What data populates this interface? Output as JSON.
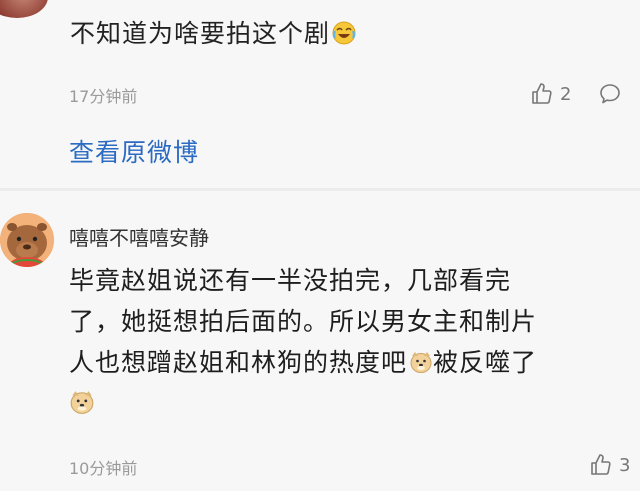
{
  "comment1": {
    "text": "不知道为啥要拍这个剧",
    "emoji_icon": "laugh-cry-emoji-icon",
    "time": "17分钟前",
    "like_count": "2",
    "view_original": "查看原微博"
  },
  "comment2": {
    "username": "嘻嘻不嘻嘻安静",
    "line1": "毕竟赵姐说还有一半没拍完，几部看完",
    "line2": "了，她挺想拍后面的。所以男女主和制片",
    "line3_a": "人也想蹭赵姐和林狗的热度吧",
    "line3_b": "被反噬了",
    "emoji_icon": "doge-emoji-icon",
    "time": "10分钟前",
    "like_count": "3"
  },
  "colors": {
    "link": "#2b6bc2",
    "meta": "#9a9a9a",
    "background": "#f7f7f7"
  }
}
